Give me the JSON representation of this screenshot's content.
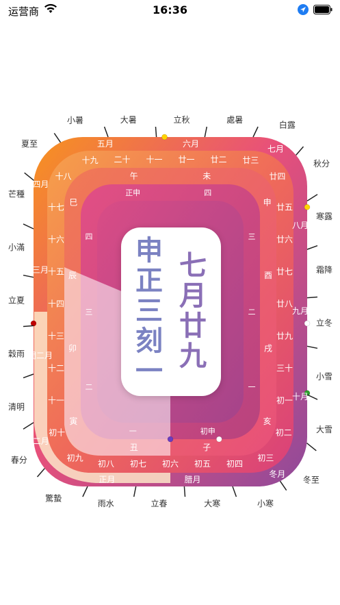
{
  "status_bar": {
    "carrier": "运营商",
    "time": "16:36"
  },
  "center": {
    "shichen": "申正三刻一",
    "lunar_date": "七月廿九"
  },
  "solar_terms": [
    {
      "label": "大暑"
    },
    {
      "label": "小暑"
    },
    {
      "label": "夏至"
    },
    {
      "label": "芒種"
    },
    {
      "label": "小滿"
    },
    {
      "label": "立夏"
    },
    {
      "label": "穀雨"
    },
    {
      "label": "清明"
    },
    {
      "label": "春分"
    },
    {
      "label": "驚蟄"
    },
    {
      "label": "雨水"
    },
    {
      "label": "立春"
    },
    {
      "label": "大寒"
    },
    {
      "label": "小寒"
    },
    {
      "label": "冬至"
    },
    {
      "label": "大雪"
    },
    {
      "label": "小雪"
    },
    {
      "label": "立冬"
    },
    {
      "label": "霜降"
    },
    {
      "label": "寒露"
    },
    {
      "label": "秋分"
    },
    {
      "label": "白露"
    },
    {
      "label": "處暑"
    },
    {
      "label": "立秋"
    }
  ],
  "months": [
    "五月",
    "四月",
    "三月",
    "閏二月",
    "二月",
    "正月",
    "腊月",
    "冬月",
    "十月",
    "九月",
    "八月",
    "七月",
    "六月"
  ],
  "days": [
    "十一",
    "二十",
    "十九",
    "十八",
    "十七",
    "十六",
    "十五",
    "十四",
    "十三",
    "十二",
    "十一",
    "初十",
    "初九",
    "初八",
    "初七",
    "初六",
    "初五",
    "初四",
    "初三",
    "初二",
    "初一",
    "三十",
    "廿九",
    "廿八",
    "廿七",
    "廿六",
    "廿五",
    "廿四",
    "廿三",
    "廿二",
    "廿一"
  ],
  "hours": [
    "午",
    "巳",
    "辰",
    "卯",
    "寅",
    "丑",
    "子",
    "亥",
    "戌",
    "酉",
    "申",
    "未"
  ],
  "quarters": [
    "正申",
    "四",
    "三",
    "二",
    "一",
    "初申",
    "一",
    "二",
    "三",
    "四"
  ],
  "colors": {
    "orange": "#f7931e",
    "coral": "#ef6a5a",
    "pink": "#e8507a",
    "magenta": "#d9407a",
    "purple": "#8f4a9a",
    "pale_peach": "#fde6c8",
    "pale_pink": "#f3c6d2"
  }
}
